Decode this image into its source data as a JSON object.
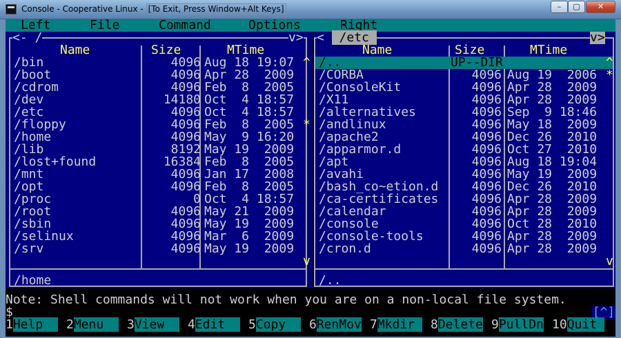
{
  "window": {
    "title": "Console - Cooperative Linux - ",
    "hint": "[To Exit, Press Window+Alt Keys]",
    "minimize": "–",
    "maximize": "▢",
    "close": "✕"
  },
  "menu": [
    "Left",
    "File",
    "Command",
    "Options",
    "Right"
  ],
  "left_panel": {
    "path": " /",
    "nav_left": "<-",
    "nav_right": "v>",
    "columns": [
      "Name",
      "Size",
      "MTime"
    ],
    "rows": [
      {
        "name": "/bin",
        "size": "4096",
        "mtime": "Aug 18 19:07"
      },
      {
        "name": "/boot",
        "size": "4096",
        "mtime": "Apr 28  2009"
      },
      {
        "name": "/cdrom",
        "size": "4096",
        "mtime": "Feb  8  2005"
      },
      {
        "name": "/dev",
        "size": "14180",
        "mtime": "Oct  4 18:57"
      },
      {
        "name": "/etc",
        "size": "4096",
        "mtime": "Oct  4 18:57"
      },
      {
        "name": "/floppy",
        "size": "4096",
        "mtime": "Feb  8  2005"
      },
      {
        "name": "/home",
        "size": "4096",
        "mtime": "May  9 16:20"
      },
      {
        "name": "/lib",
        "size": "8192",
        "mtime": "May 19  2009"
      },
      {
        "name": "/lost+found",
        "size": "16384",
        "mtime": "Feb  8  2005"
      },
      {
        "name": "/mnt",
        "size": "4096",
        "mtime": "Jan 17  2008"
      },
      {
        "name": "/opt",
        "size": "4096",
        "mtime": "Feb  8  2005"
      },
      {
        "name": "/proc",
        "size": "0",
        "mtime": "Oct  4 18:57"
      },
      {
        "name": "/root",
        "size": "4096",
        "mtime": "May 21  2009"
      },
      {
        "name": "/sbin",
        "size": "4096",
        "mtime": "May 19  2009"
      },
      {
        "name": "/selinux",
        "size": "4096",
        "mtime": "Mar  6  2009"
      },
      {
        "name": "/srv",
        "size": "4096",
        "mtime": "May 19  2009"
      }
    ],
    "scroll_up": "^",
    "scroll_mark": "*",
    "scroll_down": "v",
    "status": "/home"
  },
  "right_panel": {
    "path": " /etc ",
    "nav_left": "<",
    "nav_right": "v>",
    "columns": [
      "Name",
      "Size",
      "MTime"
    ],
    "rows": [
      {
        "name": "/..",
        "size": "UP--DIR",
        "mtime": ""
      },
      {
        "name": "/CORBA",
        "size": "4096",
        "mtime": "Aug 19  2006"
      },
      {
        "name": "/ConsoleKit",
        "size": "4096",
        "mtime": "Apr 28  2009"
      },
      {
        "name": "/X11",
        "size": "4096",
        "mtime": "Apr 28  2009"
      },
      {
        "name": "/alternatives",
        "size": "4096",
        "mtime": "Sep  9 18:46"
      },
      {
        "name": "/andlinux",
        "size": "4096",
        "mtime": "May 18  2009"
      },
      {
        "name": "/apache2",
        "size": "4096",
        "mtime": "Dec 26  2010"
      },
      {
        "name": "/apparmor.d",
        "size": "4096",
        "mtime": "Oct 27  2010"
      },
      {
        "name": "/apt",
        "size": "4096",
        "mtime": "Aug 18 19:04"
      },
      {
        "name": "/avahi",
        "size": "4096",
        "mtime": "May 19  2009"
      },
      {
        "name": "/bash_co~etion.d",
        "size": "4096",
        "mtime": "Dec 26  2010"
      },
      {
        "name": "/ca-certificates",
        "size": "4096",
        "mtime": "Apr 28  2009"
      },
      {
        "name": "/calendar",
        "size": "4096",
        "mtime": "Apr 28  2009"
      },
      {
        "name": "/console",
        "size": "4096",
        "mtime": "Oct 28  2010"
      },
      {
        "name": "/console-tools",
        "size": "4096",
        "mtime": "Apr 28  2009"
      },
      {
        "name": "/cron.d",
        "size": "4096",
        "mtime": "Apr 28  2009"
      }
    ],
    "scroll_up": "^",
    "scroll_mark": "*",
    "scroll_down": "v",
    "status": "/.."
  },
  "note": "Note: Shell commands will not work when you are on a non-local file system.",
  "prompt": "$",
  "corner_button": "[^]",
  "fkeys": [
    {
      "num": "1",
      "label": "Help  "
    },
    {
      "num": "2",
      "label": "Menu  "
    },
    {
      "num": "3",
      "label": "View  "
    },
    {
      "num": "4",
      "label": "Edit  "
    },
    {
      "num": "5",
      "label": "Copy  "
    },
    {
      "num": "6",
      "label": "RenMov"
    },
    {
      "num": "7",
      "label": "Mkdir "
    },
    {
      "num": "8",
      "label": "Delete"
    },
    {
      "num": "9",
      "label": "PullDn"
    },
    {
      "num": "10",
      "label": "Quit "
    }
  ]
}
